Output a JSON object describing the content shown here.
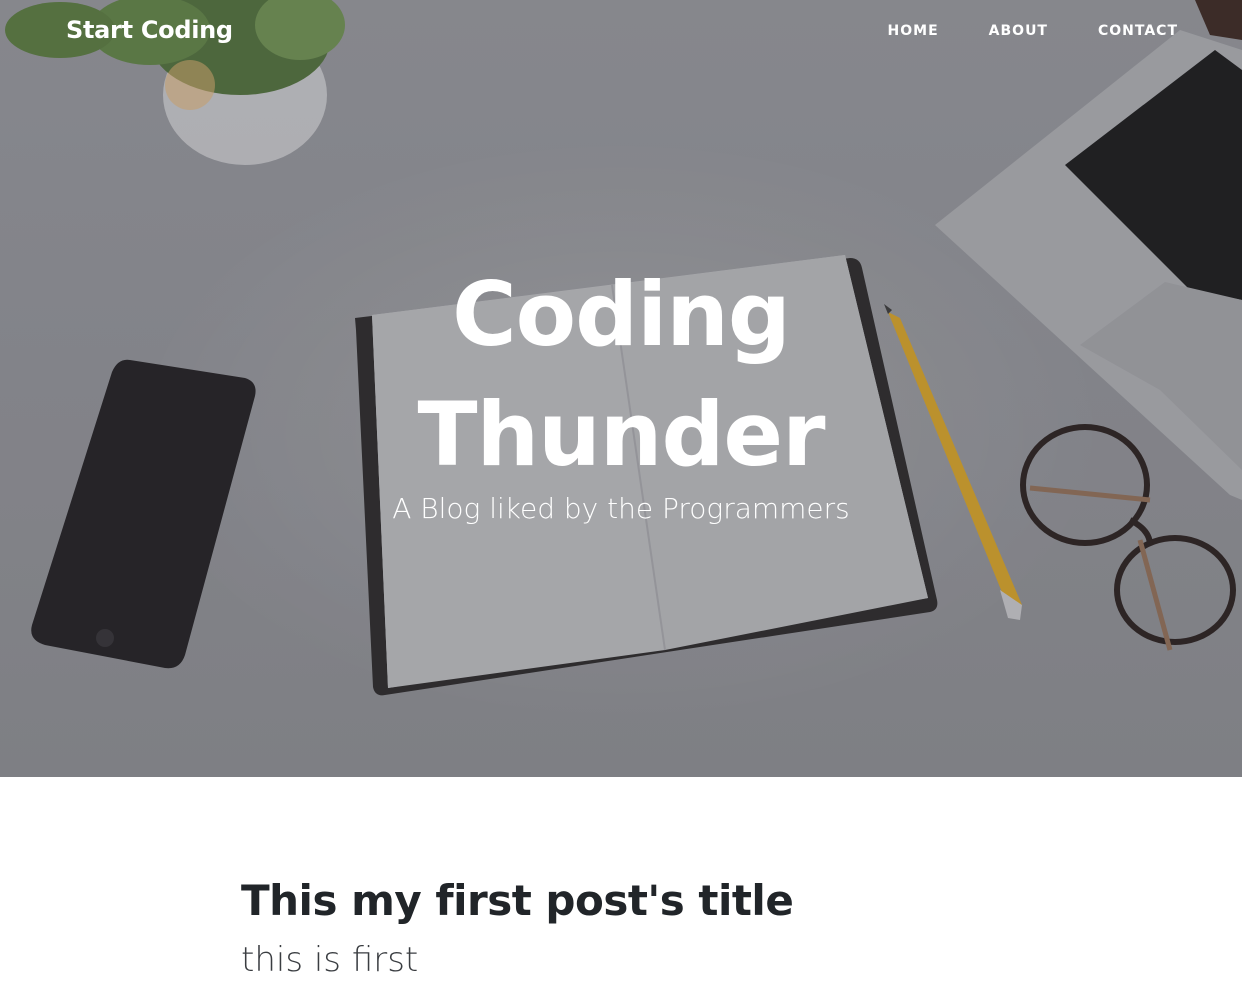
{
  "nav": {
    "brand": "Start Coding",
    "links": [
      {
        "label": "HOME"
      },
      {
        "label": "ABOUT"
      },
      {
        "label": "CONTACT"
      }
    ]
  },
  "hero": {
    "title_line1": "Coding",
    "title_line2": "Thunder",
    "subtitle": "A Blog liked by the Programmers",
    "background_color": "#8d8e92"
  },
  "posts": [
    {
      "title": "This my first post's title",
      "subtitle": "this is first"
    }
  ],
  "colors": {
    "text_dark": "#212529",
    "text_light": "#ffffff"
  }
}
